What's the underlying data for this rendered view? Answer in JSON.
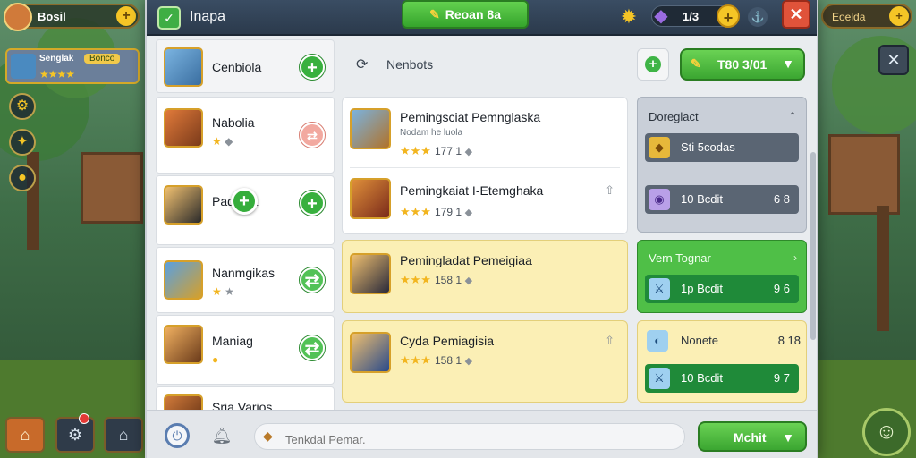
{
  "left_hud": {
    "resource_label": "Bosil",
    "resource_plus": "+",
    "player_name": "Senglak",
    "player_tag": "Bonco",
    "player_stars": "★★★★",
    "side_icons": [
      "gear-icon",
      "badge-icon",
      "record-icon"
    ]
  },
  "bottom_left": {
    "home": "⌂",
    "icon_2": "⚙",
    "icon_3": "⌂"
  },
  "right_hud": {
    "label": "Eoelda",
    "plus": "+",
    "tool": "✕",
    "avatar": "☺"
  },
  "topbar": {
    "title": "Inapa",
    "center_button": "Reoan 8a",
    "crystal_count": "1/3",
    "crystal_plus": "+",
    "anchor": "⚓",
    "close": "✕"
  },
  "list": [
    {
      "name": "Cenbiola",
      "stars": "",
      "action": "+"
    },
    {
      "name": "Nabolia",
      "stars": "★",
      "action": "⇄"
    },
    {
      "name": "Padodia",
      "stars": "",
      "action": "+"
    },
    {
      "name": "Nanmgikas",
      "stars": "★",
      "action": "⇄"
    },
    {
      "name": "Maniag",
      "stars": "●",
      "action": "⇄"
    },
    {
      "name": "Sria Varios",
      "stars": "",
      "action": ""
    }
  ],
  "float_plus": "+",
  "section": {
    "title": "Nenbots",
    "score_button": "T80 3/01"
  },
  "cards": [
    {
      "title": "Pemingsciat Pemnglaska",
      "sub": "Nodam he luola",
      "stars": "★★★",
      "num": "177 1",
      "pinned": false
    },
    {
      "title": "Pemingkaiat I-Etemghaka",
      "sub": "",
      "stars": "★★★",
      "num": "179 1",
      "pinned": true
    },
    {
      "title": "Pemingladat Pemeigiaa",
      "sub": "",
      "stars": "★★★",
      "num": "158 1",
      "pinned": false
    },
    {
      "title": "Cyda Pemiagisia",
      "sub": "",
      "stars": "★★★",
      "num": "158 1",
      "pinned": true
    }
  ],
  "right_panels": {
    "grey": {
      "head": "Doreglact",
      "row1_label": "Sti 5codas",
      "row2_label": "10 Bcdit",
      "row2_val": "6 8"
    },
    "green": {
      "head": "Vern Tognar",
      "row_label": "1p Bcdit",
      "row_val": "9 6"
    },
    "yellow": {
      "head": "Nonete",
      "head_val": "8 18",
      "row_label": "10 Bcdit",
      "row_val": "9 7"
    }
  },
  "footer": {
    "chat_placeholder": "Tenkdal Pemar.",
    "send_label": "Mchit"
  }
}
